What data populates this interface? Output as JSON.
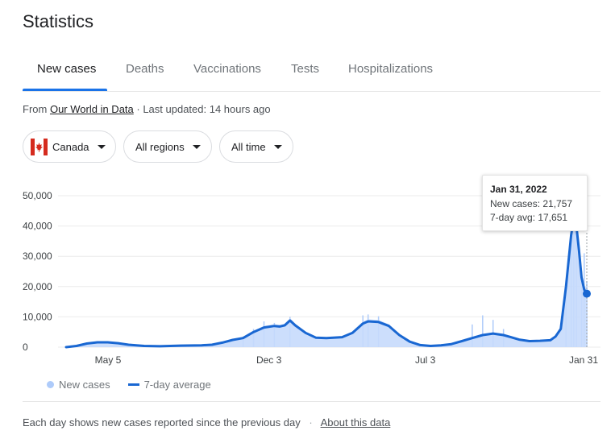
{
  "header": {
    "title": "Statistics"
  },
  "tabs": [
    {
      "label": "New cases",
      "active": true
    },
    {
      "label": "Deaths",
      "active": false
    },
    {
      "label": "Vaccinations",
      "active": false
    },
    {
      "label": "Tests",
      "active": false
    },
    {
      "label": "Hospitalizations",
      "active": false
    }
  ],
  "source": {
    "prefix": "From",
    "link": "Our World in Data",
    "updated": "· Last updated: 14 hours ago"
  },
  "filters": {
    "region": "Canada",
    "subregion": "All regions",
    "period": "All time"
  },
  "tooltip": {
    "date": "Jan 31, 2022",
    "cases": "New cases: 21,757",
    "avg": "7-day avg: 17,651"
  },
  "legend": {
    "bars": "New cases",
    "line": "7-day average"
  },
  "footer": {
    "note": "Each day shows new cases reported since the previous day",
    "link": "About this data"
  },
  "colors": {
    "accent": "#1a73e8",
    "line": "#1967d2",
    "bars": "#aecbfa"
  },
  "chart_data": {
    "type": "area",
    "y_ticks": [
      "0",
      "10,000",
      "20,000",
      "30,000",
      "40,000",
      "50,000"
    ],
    "ylim": [
      0,
      50000
    ],
    "x_tick_labels": [
      "May 5",
      "Dec 3",
      "Jul 3",
      "Jan 31"
    ],
    "x_tick_positions": [
      0.08,
      0.39,
      0.695,
      1.0
    ],
    "grid": true,
    "legend_position": "bottom-left",
    "series": [
      {
        "name": "7-day average",
        "points": [
          [
            0.0,
            0
          ],
          [
            0.02,
            400
          ],
          [
            0.04,
            1200
          ],
          [
            0.06,
            1600
          ],
          [
            0.08,
            1600
          ],
          [
            0.1,
            1300
          ],
          [
            0.12,
            800
          ],
          [
            0.15,
            400
          ],
          [
            0.18,
            300
          ],
          [
            0.22,
            500
          ],
          [
            0.26,
            600
          ],
          [
            0.28,
            800
          ],
          [
            0.3,
            1500
          ],
          [
            0.32,
            2400
          ],
          [
            0.34,
            3000
          ],
          [
            0.36,
            5000
          ],
          [
            0.38,
            6500
          ],
          [
            0.4,
            7000
          ],
          [
            0.41,
            6800
          ],
          [
            0.42,
            7200
          ],
          [
            0.43,
            8800
          ],
          [
            0.44,
            7200
          ],
          [
            0.46,
            4700
          ],
          [
            0.48,
            3100
          ],
          [
            0.5,
            3000
          ],
          [
            0.53,
            3300
          ],
          [
            0.55,
            4700
          ],
          [
            0.57,
            7800
          ],
          [
            0.58,
            8500
          ],
          [
            0.6,
            8300
          ],
          [
            0.62,
            7000
          ],
          [
            0.64,
            4000
          ],
          [
            0.66,
            1800
          ],
          [
            0.68,
            700
          ],
          [
            0.7,
            400
          ],
          [
            0.72,
            600
          ],
          [
            0.74,
            1000
          ],
          [
            0.76,
            2000
          ],
          [
            0.78,
            3000
          ],
          [
            0.8,
            4000
          ],
          [
            0.82,
            4500
          ],
          [
            0.84,
            4000
          ],
          [
            0.85,
            3500
          ],
          [
            0.87,
            2500
          ],
          [
            0.89,
            2000
          ],
          [
            0.91,
            2100
          ],
          [
            0.93,
            2300
          ],
          [
            0.94,
            3500
          ],
          [
            0.95,
            6000
          ],
          [
            0.96,
            20000
          ],
          [
            0.97,
            37000
          ],
          [
            0.975,
            42500
          ],
          [
            0.98,
            40000
          ],
          [
            0.985,
            32000
          ],
          [
            0.99,
            23000
          ],
          [
            0.995,
            19000
          ],
          [
            1.0,
            17651
          ]
        ]
      }
    ],
    "new_cases_bar_peaks": [
      [
        0.34,
        3500
      ],
      [
        0.36,
        6000
      ],
      [
        0.38,
        8500
      ],
      [
        0.4,
        8000
      ],
      [
        0.43,
        10000
      ],
      [
        0.57,
        10500
      ],
      [
        0.58,
        10800
      ],
      [
        0.6,
        10200
      ],
      [
        0.78,
        7500
      ],
      [
        0.8,
        10500
      ],
      [
        0.82,
        9000
      ],
      [
        0.84,
        6000
      ],
      [
        0.96,
        22000
      ],
      [
        0.97,
        42000
      ],
      [
        0.975,
        46000
      ],
      [
        0.98,
        38000
      ],
      [
        0.99,
        25000
      ],
      [
        0.995,
        31000
      ],
      [
        1.0,
        21757
      ]
    ],
    "highlight": {
      "x": 1.0,
      "new_cases": 21757,
      "avg": 17651
    }
  }
}
